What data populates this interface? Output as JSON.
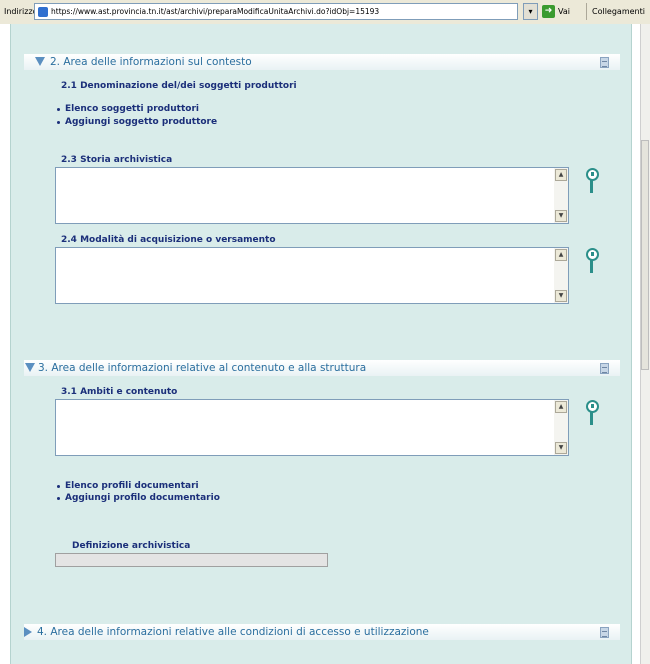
{
  "addressbar": {
    "label": "Indirizzo",
    "url": "https://www.ast.provincia.tn.it/ast/archivi/preparaModificaUnitaArchivi.do?idObj=15193",
    "go_label": "Vai",
    "links_label": "Collegamenti"
  },
  "section2": {
    "title": "2. Area delle informazioni sul contesto",
    "sub21": "2.1 Denominazione del/dei soggetti produttori",
    "links": [
      "Elenco soggetti produttori",
      "Aggiungi soggetto produttore"
    ],
    "field23_label": "2.3 Storia archivistica",
    "field23_value": "",
    "field24_label": "2.4 Modalità di acquisizione o versamento",
    "field24_value": ""
  },
  "section3": {
    "title": "3. Area delle informazioni relative al contenuto e alla struttura",
    "field31_label": "3.1 Ambiti e contenuto",
    "field31_value": "",
    "links": [
      "Elenco profili documentari",
      "Aggiungi profilo documentario"
    ],
    "def_label": "Definizione archivistica",
    "def_value": ""
  },
  "section4": {
    "title": "4. Area delle informazioni relative alle condizioni di accesso e utilizzazione"
  },
  "icons": {
    "expanded": "arrow-down-icon",
    "collapsed": "arrow-right-icon",
    "doc": "document-icon",
    "help": "help-pin-icon"
  },
  "colors": {
    "panel_bg": "#d9ecea",
    "section_title": "#2a6e9e",
    "label": "#1b2f7a",
    "help_icon": "#2b8f8a"
  }
}
